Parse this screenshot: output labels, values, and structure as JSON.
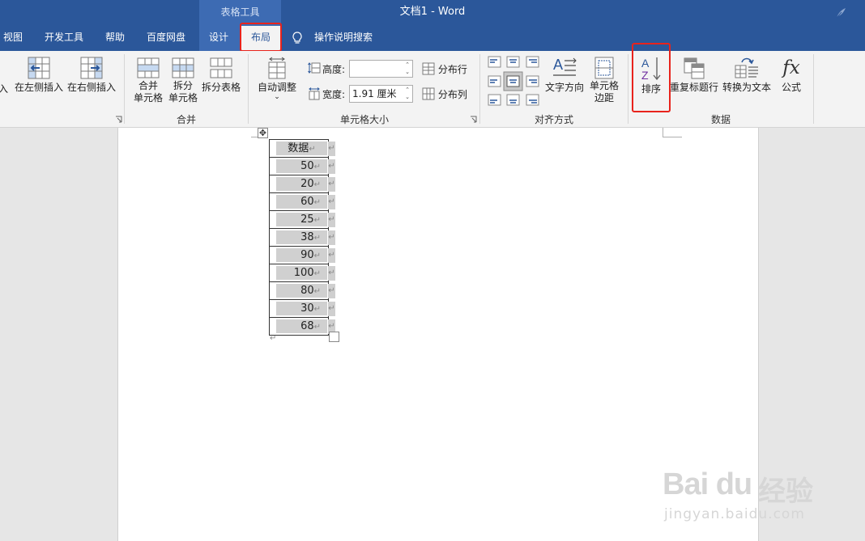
{
  "titlebar": {
    "context_group": "表格工具",
    "document_title": "文档1  -  Word"
  },
  "tabs": [
    {
      "label": "视图",
      "active": false
    },
    {
      "label": "开发工具",
      "active": false
    },
    {
      "label": "帮助",
      "active": false
    },
    {
      "label": "百度网盘",
      "active": false
    },
    {
      "label": "设计",
      "active": false
    },
    {
      "label": "布局",
      "active": true
    }
  ],
  "tell_me": "操作说明搜索",
  "ribbon": {
    "rows_columns": {
      "insert_partial": "入",
      "insert_left": "在左侧插入",
      "insert_right": "在右侧插入"
    },
    "merge": {
      "merge_cells": [
        "合并",
        "单元格"
      ],
      "split_cells": [
        "拆分",
        "单元格"
      ],
      "split_table": "拆分表格",
      "group_label": "合并"
    },
    "cell_size": {
      "autofit": "自动调整",
      "height_label": "高度:",
      "height_value": "",
      "width_label": "宽度:",
      "width_value": "1.91 厘米",
      "distribute_rows": "分布行",
      "distribute_cols": "分布列",
      "group_label": "单元格大小"
    },
    "alignment": {
      "text_direction": "文字方向",
      "cell_margins": [
        "单元格",
        "边距"
      ],
      "group_label": "对齐方式"
    },
    "data": {
      "sort": "排序",
      "repeat_header": "重复标题行",
      "convert_to_text": "转换为文本",
      "formula": "公式",
      "formula_glyph": "fx",
      "group_label": "数据"
    }
  },
  "table": {
    "header": "数据",
    "values": [
      "50",
      "20",
      "60",
      "25",
      "38",
      "90",
      "100",
      "80",
      "30",
      "68"
    ],
    "para_mark": "↵"
  },
  "watermark": {
    "brand": "Bai du",
    "cn": "经验",
    "url": "jingyan.baidu.com"
  },
  "colors": {
    "titlebar": "#2b579a",
    "context_tab": "#3d6bb3",
    "highlight": "#e8231c",
    "sort_icon_blue": "#2b579a",
    "sort_icon_purple": "#7030a0"
  }
}
